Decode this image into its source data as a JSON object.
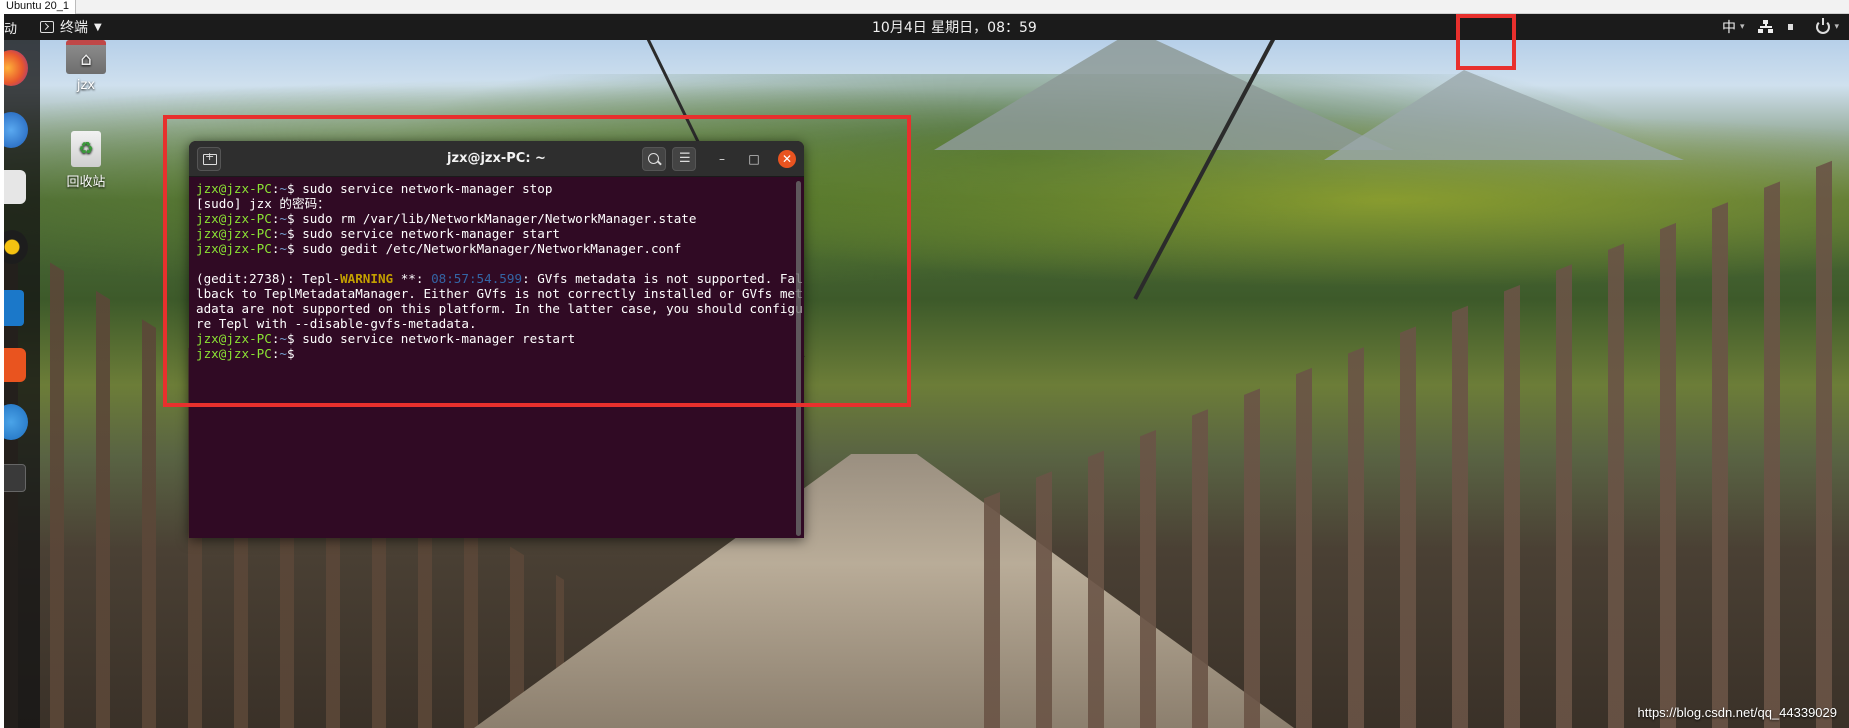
{
  "host": {
    "tab_label": "Ubuntu 20_1"
  },
  "topbar": {
    "activities": "动",
    "app_menu_label": "终端",
    "clock": "10月4日 星期日，08：59",
    "input_method": "中",
    "icons": [
      "terminal-icon",
      "network-wired-icon",
      "volume-icon",
      "power-icon"
    ]
  },
  "dock": {
    "items": [
      "firefox-icon",
      "thunderbird-icon",
      "files-icon",
      "rhythmbox-icon",
      "libreoffice-writer-icon",
      "software-store-icon",
      "help-icon",
      "show-apps-icon"
    ]
  },
  "desktop": {
    "home_label": "jzx",
    "trash_label": "回收站"
  },
  "terminal": {
    "title": "jzx@jzx-PC: ~",
    "prompt_user": "jzx@jzx-PC",
    "prompt_path": "~",
    "prompt_symbol": "$",
    "lines": [
      {
        "type": "cmd",
        "text": " sudo service network-manager stop"
      },
      {
        "type": "out",
        "text": "[sudo] jzx 的密码："
      },
      {
        "type": "cmd",
        "text": " sudo rm /var/lib/NetworkManager/NetworkManager.state"
      },
      {
        "type": "cmd",
        "text": " sudo service network-manager start"
      },
      {
        "type": "cmd",
        "text": " sudo gedit /etc/NetworkManager/NetworkManager.conf"
      },
      {
        "type": "out",
        "text": ""
      },
      {
        "type": "warn",
        "prefix": "(gedit:2738): Tepl-",
        "level": "WARNING",
        "mid": " **: ",
        "time": "08:57:54.599",
        "rest": ": GVfs metadata is not supported. Fal"
      },
      {
        "type": "out",
        "text": "lback to TeplMetadataManager. Either GVfs is not correctly installed or GVfs met"
      },
      {
        "type": "out",
        "text": "adata are not supported on this platform. In the latter case, you should configu"
      },
      {
        "type": "out",
        "text": "re Tepl with --disable-gvfs-metadata."
      },
      {
        "type": "cmd",
        "text": " sudo service network-manager restart"
      },
      {
        "type": "cmd",
        "text": ""
      }
    ]
  },
  "watermark": "https://blog.csdn.net/qq_44339029",
  "colors": {
    "terminal_bg": "#300a24",
    "prompt_user": "#8ae234",
    "prompt_path": "#729fcf",
    "warning": "#c4a000",
    "timestamp": "#3465a4",
    "close_button": "#e95420",
    "annotation_red": "#e8302d"
  }
}
